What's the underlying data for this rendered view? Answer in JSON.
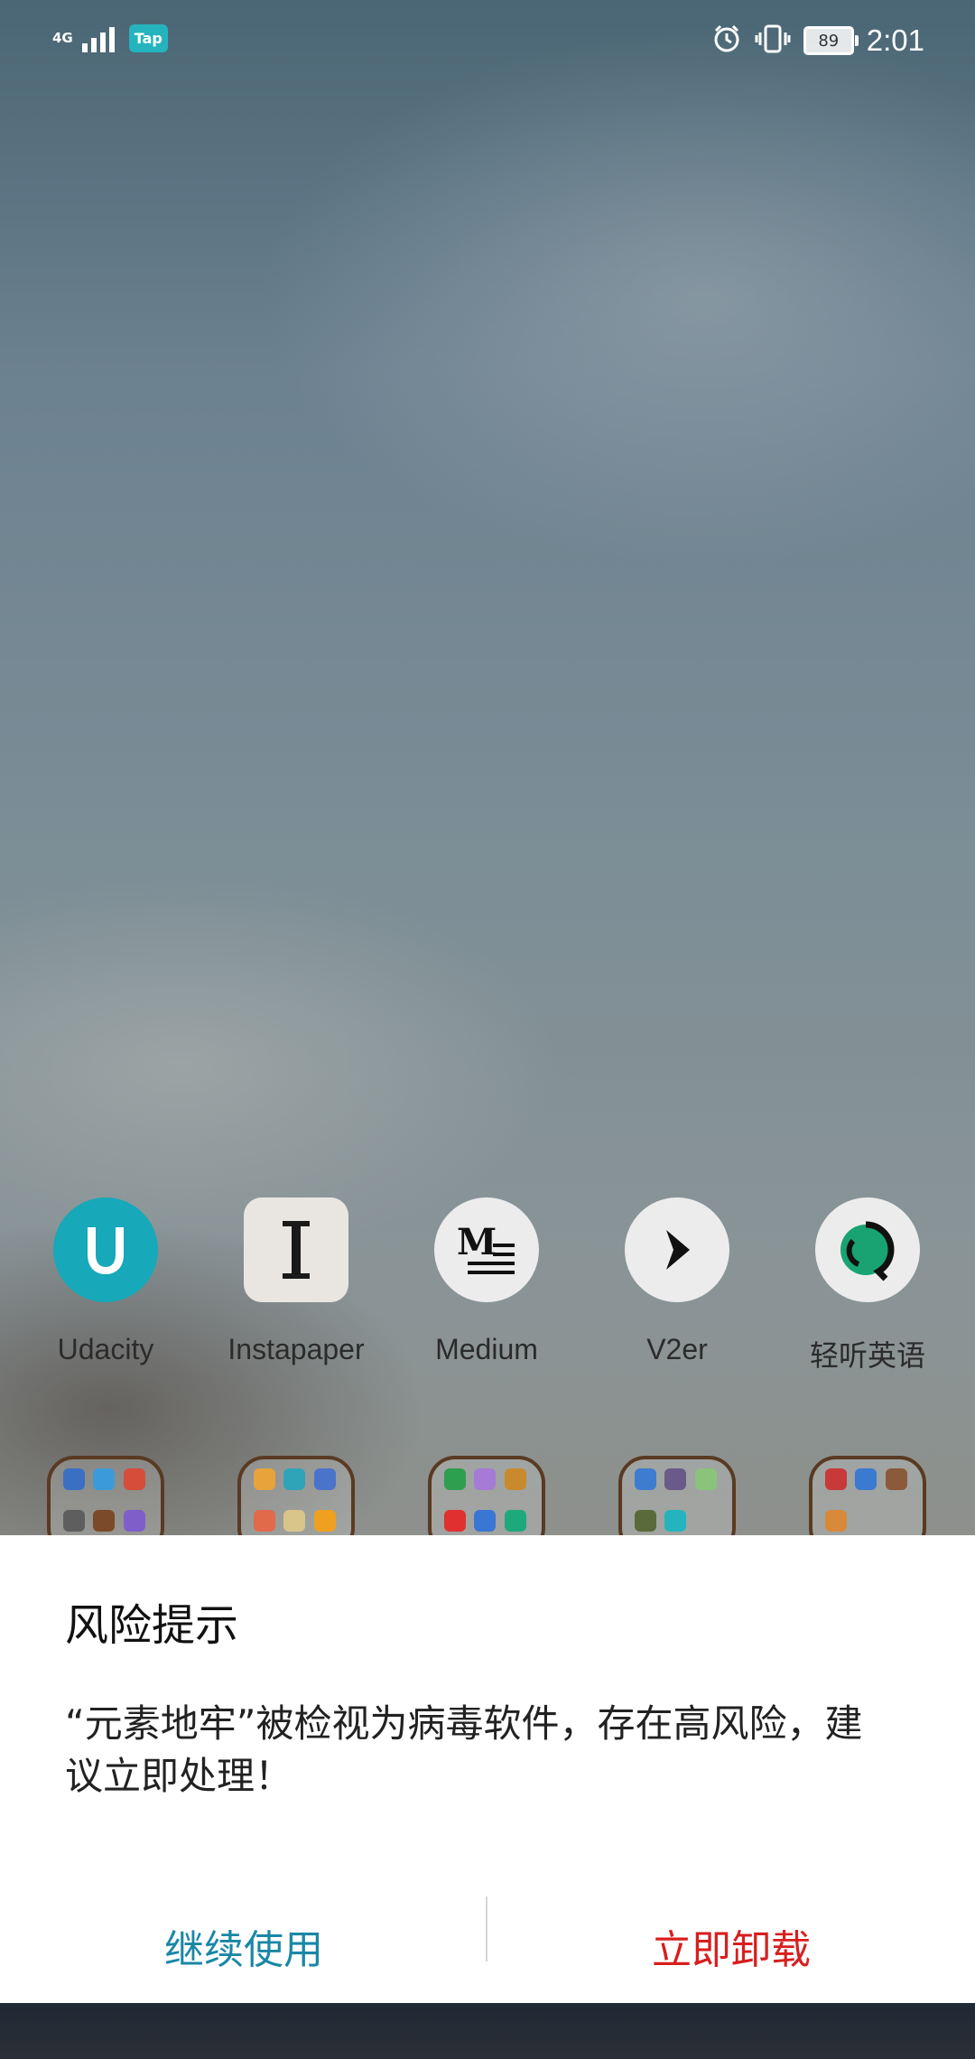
{
  "status_bar": {
    "network": "4G",
    "tap_badge": "Tap",
    "battery": "89",
    "time": "2:01"
  },
  "apps": [
    {
      "label": "Udacity",
      "icon": "udacity-icon"
    },
    {
      "label": "Instapaper",
      "icon": "instapaper-icon"
    },
    {
      "label": "Medium",
      "icon": "medium-icon"
    },
    {
      "label": "V2er",
      "icon": "v2er-icon"
    },
    {
      "label": "轻听英语",
      "icon": "qingting-english-icon"
    }
  ],
  "dialog": {
    "title": "风险提示",
    "message": "“元素地牢”被检视为病毒软件，存在高风险，建议立即处理！",
    "continue_label": "继续使用",
    "uninstall_label": "立即卸载"
  },
  "colors": {
    "continue": "#1a87a6",
    "uninstall": "#d81e1e",
    "udacity": "#17a8b9",
    "qingting": "#1aa372"
  }
}
